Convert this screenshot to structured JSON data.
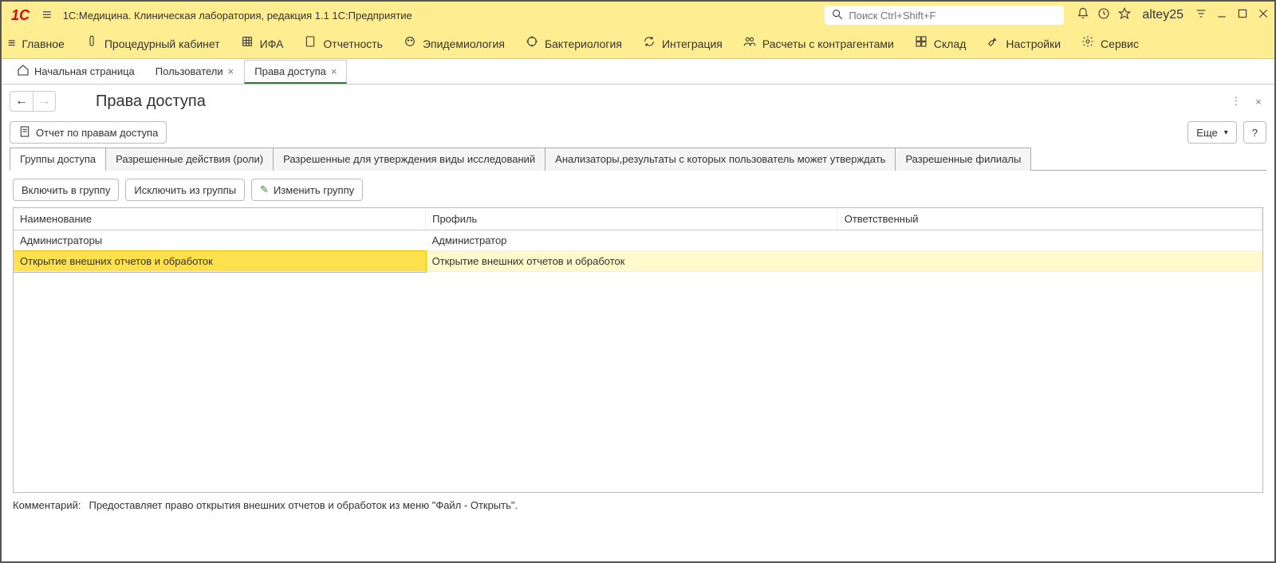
{
  "titlebar": {
    "app_title": "1С:Медицина. Клиническая лаборатория, редакция 1.1 1С:Предприятие",
    "search_placeholder": "Поиск Ctrl+Shift+F",
    "username": "altey25"
  },
  "menubar": [
    {
      "label": "Главное"
    },
    {
      "label": "Процедурный кабинет"
    },
    {
      "label": "ИФА"
    },
    {
      "label": "Отчетность"
    },
    {
      "label": "Эпидемиология"
    },
    {
      "label": "Бактериология"
    },
    {
      "label": "Интеграция"
    },
    {
      "label": "Расчеты с контрагентами"
    },
    {
      "label": "Склад"
    },
    {
      "label": "Настройки"
    },
    {
      "label": "Сервис"
    }
  ],
  "navtabs": {
    "home": "Начальная страница",
    "tab1": "Пользователи",
    "tab2": "Права доступа"
  },
  "page": {
    "title": "Права доступа",
    "report_btn": "Отчет по правам доступа",
    "more_btn": "Еще",
    "help_btn": "?"
  },
  "innertabs": [
    "Группы доступа",
    "Разрешенные действия (роли)",
    "Разрешенные для утверждения виды исследований",
    "Анализаторы,результаты с которых пользователь может утверждать",
    "Разрешенные филиалы"
  ],
  "actions": {
    "include": "Включить в группу",
    "exclude": "Исключить из группы",
    "edit": "Изменить группу"
  },
  "table": {
    "columns": [
      "Наименование",
      "Профиль",
      "Ответственный"
    ],
    "rows": [
      {
        "name": "Администраторы",
        "profile": "Администратор",
        "resp": ""
      },
      {
        "name": "Открытие внешних отчетов и обработок",
        "profile": "Открытие внешних отчетов и обработок",
        "resp": ""
      }
    ],
    "selected_index": 1
  },
  "comment": {
    "label": "Комментарий:",
    "text": "Предоставляет право открытия внешних отчетов и обработок из меню \"Файл - Открыть\"."
  }
}
